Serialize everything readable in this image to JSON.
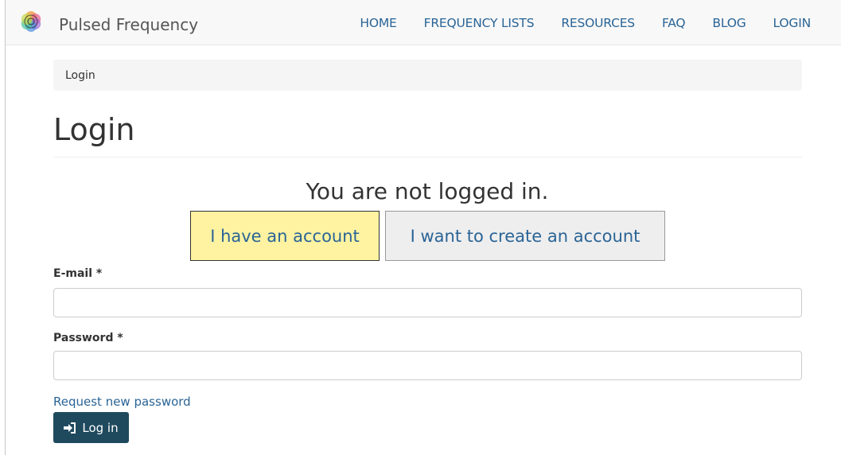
{
  "header": {
    "brand": "Pulsed Frequency",
    "nav": [
      "HOME",
      "FREQUENCY LISTS",
      "RESOURCES",
      "FAQ",
      "BLOG",
      "LOGIN"
    ]
  },
  "breadcrumb": "Login",
  "page_title": "Login",
  "status_text": "You are not logged in.",
  "account_buttons": {
    "have": "I have an account",
    "create": "I want to create an account"
  },
  "form": {
    "email_label": "E-mail *",
    "email_value": "",
    "password_label": "Password *",
    "password_value": "",
    "request_password": "Request new password",
    "submit": "Log in"
  },
  "colors": {
    "link": "#2a6496",
    "highlight_button": "#fff3a1",
    "primary_button": "#1f4a5e"
  },
  "icons": [
    "flower-of-life-logo-icon",
    "sign-in-icon"
  ]
}
